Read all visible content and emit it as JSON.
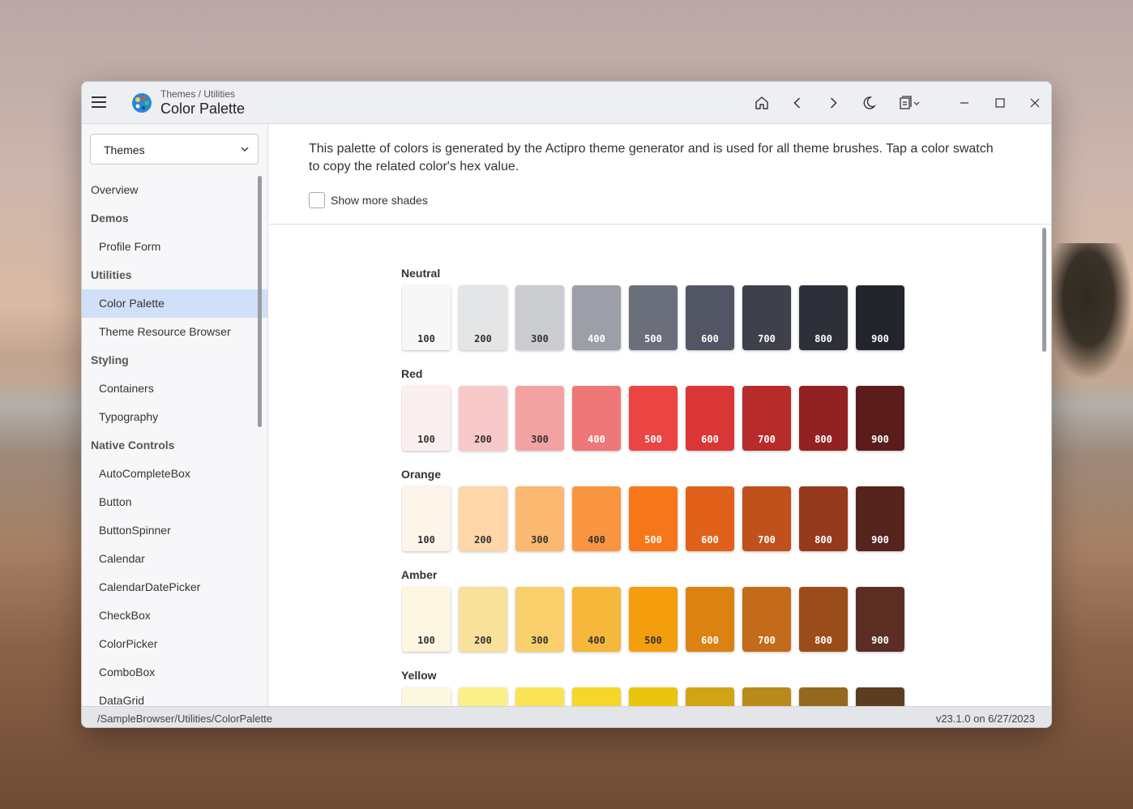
{
  "window": {
    "breadcrumb": "Themes / Utilities",
    "title": "Color Palette"
  },
  "titlebar_icons": [
    "home-icon",
    "back-icon",
    "forward-icon",
    "dark-mode-icon",
    "clipboard-menu-icon",
    "minimize-icon",
    "maximize-icon",
    "close-icon"
  ],
  "sidebar": {
    "combo_value": "Themes",
    "items": [
      {
        "label": "Overview",
        "kind": "top",
        "name": "sidebar-item-overview"
      },
      {
        "label": "Demos",
        "kind": "group",
        "name": "sidebar-group-demos"
      },
      {
        "label": "Profile Form",
        "kind": "item",
        "name": "sidebar-item-profile-form"
      },
      {
        "label": "Utilities",
        "kind": "group",
        "name": "sidebar-group-utilities"
      },
      {
        "label": "Color Palette",
        "kind": "selected",
        "name": "sidebar-item-color-palette"
      },
      {
        "label": "Theme Resource Browser",
        "kind": "item",
        "name": "sidebar-item-theme-resource-browser"
      },
      {
        "label": "Styling",
        "kind": "group",
        "name": "sidebar-group-styling"
      },
      {
        "label": "Containers",
        "kind": "item",
        "name": "sidebar-item-containers"
      },
      {
        "label": "Typography",
        "kind": "item",
        "name": "sidebar-item-typography"
      },
      {
        "label": "Native Controls",
        "kind": "group",
        "name": "sidebar-group-native-controls"
      },
      {
        "label": "AutoCompleteBox",
        "kind": "item",
        "name": "sidebar-item-autocompletebox"
      },
      {
        "label": "Button",
        "kind": "item",
        "name": "sidebar-item-button"
      },
      {
        "label": "ButtonSpinner",
        "kind": "item",
        "name": "sidebar-item-buttonspinner"
      },
      {
        "label": "Calendar",
        "kind": "item",
        "name": "sidebar-item-calendar"
      },
      {
        "label": "CalendarDatePicker",
        "kind": "item",
        "name": "sidebar-item-calendardatepicker"
      },
      {
        "label": "CheckBox",
        "kind": "item",
        "name": "sidebar-item-checkbox"
      },
      {
        "label": "ColorPicker",
        "kind": "item",
        "name": "sidebar-item-colorpicker"
      },
      {
        "label": "ComboBox",
        "kind": "item",
        "name": "sidebar-item-combobox"
      },
      {
        "label": "DataGrid",
        "kind": "item",
        "name": "sidebar-item-datagrid"
      }
    ]
  },
  "content": {
    "intro": "This palette of colors is generated by the Actipro theme generator and is used for all theme brushes.  Tap a color swatch to copy the related color's hex value.",
    "show_more_label": "Show more shades",
    "show_more_checked": false
  },
  "palette": {
    "shades": [
      "100",
      "200",
      "300",
      "400",
      "500",
      "600",
      "700",
      "800",
      "900"
    ],
    "groups": [
      {
        "name": "Neutral",
        "colors": [
          "#f7f7f8",
          "#e4e5e7",
          "#cacccf",
          "#9c9fa7",
          "#6b6e7b",
          "#525563",
          "#3e414c",
          "#2d3038",
          "#22252b"
        ],
        "text_colors": [
          "#333333",
          "#333333",
          "#333333",
          "#ffffff",
          "#ffffff",
          "#ffffff",
          "#ffffff",
          "#ffffff",
          "#ffffff"
        ]
      },
      {
        "name": "Red",
        "colors": [
          "#fcefef",
          "#f8c9c9",
          "#f3a2a2",
          "#ef7777",
          "#ec4343",
          "#d93636",
          "#b82b2b",
          "#922222",
          "#5b1c1c"
        ],
        "text_colors": [
          "#333333",
          "#333333",
          "#333333",
          "#ffffff",
          "#ffffff",
          "#ffffff",
          "#ffffff",
          "#ffffff",
          "#ffffff"
        ]
      },
      {
        "name": "Orange",
        "colors": [
          "#fdf4ea",
          "#fed6a8",
          "#fbb871",
          "#f99540",
          "#f8761a",
          "#e0621a",
          "#c0501c",
          "#963a1d",
          "#55241c"
        ],
        "text_colors": [
          "#333333",
          "#333333",
          "#333333",
          "#333333",
          "#ffffff",
          "#ffffff",
          "#ffffff",
          "#ffffff",
          "#ffffff"
        ]
      },
      {
        "name": "Amber",
        "colors": [
          "#fdf6e1",
          "#f9e19b",
          "#f8cf6a",
          "#f6b83b",
          "#f49e0e",
          "#dc8212",
          "#c36a1b",
          "#9a4d1b",
          "#5c2d22"
        ],
        "text_colors": [
          "#333333",
          "#333333",
          "#333333",
          "#333333",
          "#333333",
          "#ffffff",
          "#ffffff",
          "#ffffff",
          "#ffffff"
        ]
      },
      {
        "name": "Yellow",
        "colors": [
          "#fdf9df",
          "#fbef8a",
          "#fae456",
          "#f5d72a",
          "#e9c50d",
          "#d0a414",
          "#b78a1b",
          "#94691f",
          "#5b3e21"
        ],
        "text_colors": [
          "#333333",
          "#333333",
          "#333333",
          "#333333",
          "#333333",
          "#333333",
          "#ffffff",
          "#ffffff",
          "#ffffff"
        ]
      }
    ]
  },
  "status": {
    "path": "/SampleBrowser/Utilities/ColorPalette",
    "version": "v23.1.0 on 6/27/2023"
  }
}
